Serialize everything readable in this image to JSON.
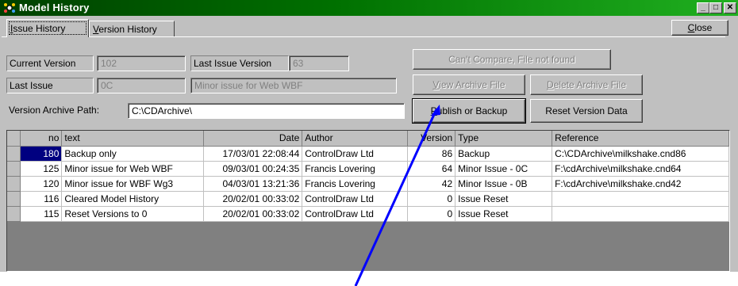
{
  "window": {
    "title": "Model History",
    "title_icon": "model-history-icon"
  },
  "titlebar_buttons": {
    "minimize": "_",
    "maximize": "□",
    "close": "✕"
  },
  "tabs": [
    {
      "label": "Issue History",
      "mnemonic": "I",
      "rest": "ssue History",
      "active": true
    },
    {
      "label": "Version History",
      "mnemonic": "V",
      "rest": "ersion History",
      "active": false
    }
  ],
  "close_button": {
    "label": "Close",
    "mnemonic": "C",
    "rest": "lose"
  },
  "form": {
    "current_version_label": "Current Version",
    "current_version_value": "102",
    "last_issue_version_label": "Last Issue Version",
    "last_issue_version_value": "63",
    "last_issue_label": "Last Issue",
    "last_issue_value": "0C",
    "last_issue_desc": "Minor issue for Web WBF",
    "archive_path_label": "Version Archive Path:",
    "archive_path_value": "C:\\CDArchive\\"
  },
  "buttons": {
    "compare": "Can't Compare, File not found",
    "view_archive_m": "V",
    "view_archive_rest": "iew Archive File",
    "delete_archive_m": "D",
    "delete_archive_rest": "elete Archive File",
    "publish_m": "P",
    "publish_rest": "ublish or Backup",
    "reset_version": "Reset Version Data"
  },
  "table": {
    "columns": [
      "no",
      "text",
      "Date",
      "Author",
      "Version",
      "Type",
      "Reference"
    ],
    "rows": [
      {
        "no": "180",
        "text": "Backup only",
        "date": "17/03/01 22:08:44",
        "author": "ControlDraw Ltd",
        "version": "86",
        "type": "Backup",
        "reference": "C:\\CDArchive\\milkshake.cnd86"
      },
      {
        "no": "125",
        "text": "Minor issue for Web WBF",
        "date": "09/03/01 00:24:35",
        "author": "Francis Lovering",
        "version": "64",
        "type": "Minor Issue - 0C",
        "reference": "F:\\cdArchive\\milkshake.cnd64"
      },
      {
        "no": "120",
        "text": "Minor issue for WBF Wg3",
        "date": "04/03/01 13:21:36",
        "author": "Francis Lovering",
        "version": "42",
        "type": "Minor Issue - 0B",
        "reference": "F:\\cdArchive\\milkshake.cnd42"
      },
      {
        "no": "116",
        "text": "Cleared Model History",
        "date": "20/02/01 00:33:02",
        "author": "ControlDraw Ltd",
        "version": "0",
        "type": "Issue Reset",
        "reference": ""
      },
      {
        "no": "115",
        "text": "Reset Versions to 0",
        "date": "20/02/01 00:33:02",
        "author": "ControlDraw Ltd",
        "version": "0",
        "type": "Issue Reset",
        "reference": ""
      }
    ]
  },
  "colors": {
    "title_start": "#004000",
    "title_end": "#20b020",
    "selection": "#000080",
    "annotation": "#0000ff"
  }
}
